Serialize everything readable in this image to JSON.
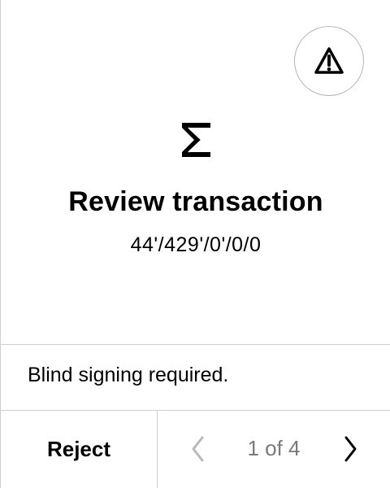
{
  "screen": {
    "title": "Review transaction",
    "derivation_path": "44'/429'/0'/0/0",
    "notice": "Blind signing required.",
    "reject_label": "Reject",
    "page_indicator": "1 of 4"
  },
  "icons": {
    "warning": "warning-triangle-icon",
    "app": "sigma-icon",
    "previous": "chevron-left-icon",
    "next": "chevron-right-icon"
  },
  "colors": {
    "text": "#000000",
    "muted_text": "#7a7a7a",
    "divider": "#cfcfcf",
    "background": "#ffffff"
  }
}
